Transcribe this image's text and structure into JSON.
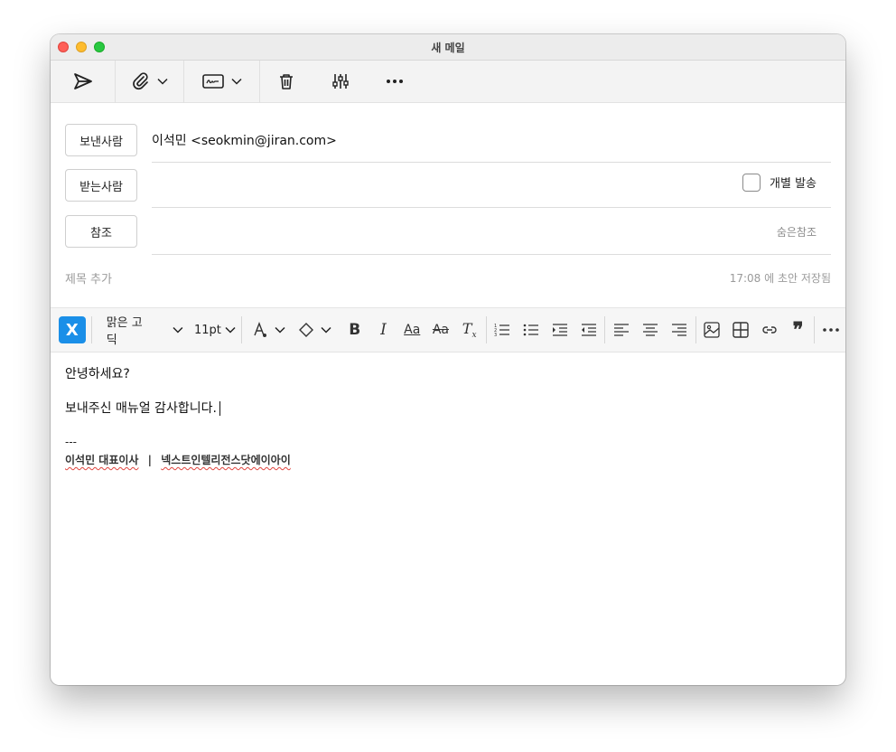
{
  "window": {
    "title": "새 메일"
  },
  "toolbar": {
    "icons": [
      "send-icon",
      "attach-icon",
      "signature-icon",
      "trash-icon",
      "options-icon",
      "more-icon"
    ]
  },
  "headers": {
    "from_label": "보낸사람",
    "from_value": "이석민 <seokmin@jiran.com>",
    "to_label": "받는사람",
    "individual_send_label": "개별 발송",
    "cc_label": "참조",
    "bcc_label": "숨은참조",
    "subject_placeholder": "제목 추가",
    "saved_status": "17:08 에 초안 저장됨"
  },
  "editor": {
    "font_family": "맑은 고딕",
    "font_size": "11pt"
  },
  "body": {
    "line1": "안녕하세요?",
    "line2": "보내주신 매뉴얼 감사합니다.",
    "sig_dash": "---",
    "sig_name": "이석민 대표이사",
    "sig_sep": "|",
    "sig_company": "넥스트인텔리전스닷에이아이"
  },
  "colors": {
    "accent": "#1a8fe8",
    "close": "#ff5f57",
    "minimize": "#febc2e",
    "maximize": "#28c840"
  }
}
